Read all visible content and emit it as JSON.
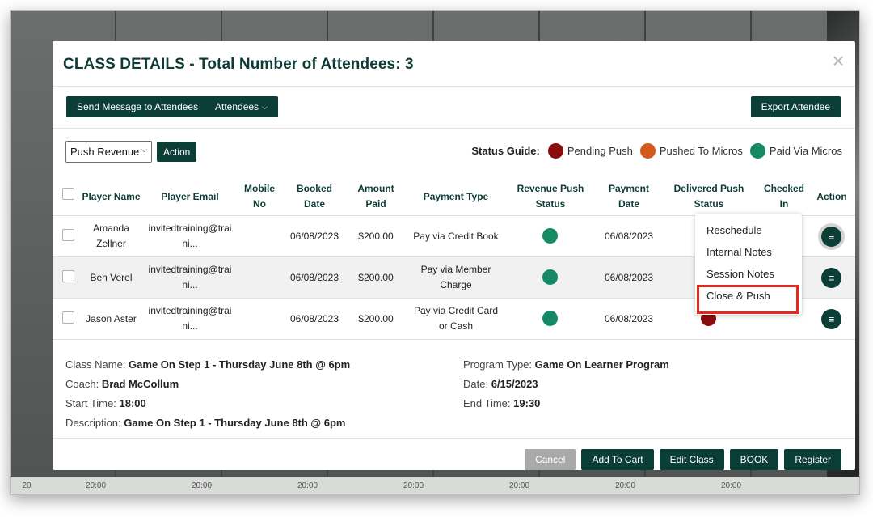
{
  "modal": {
    "title": "CLASS DETAILS - Total Number of Attendees: 3",
    "close_glyph": "×",
    "send_message_label": "Send Message to Attendees",
    "attendees_label": "Attendees",
    "attendees_chevron": "⌵",
    "export_label": "Export Attendee"
  },
  "toolbar": {
    "select_value": "Push Revenue",
    "select_chevron": "⌵",
    "action_label": "Action",
    "status_guide_label": "Status Guide:",
    "statuses": [
      {
        "label": "Pending Push",
        "color": "#8a0d0d"
      },
      {
        "label": "Pushed To Micros",
        "color": "#d45a1c"
      },
      {
        "label": "Paid Via Micros",
        "color": "#158a64"
      }
    ]
  },
  "table": {
    "headers": {
      "player_name": "Player Name",
      "player_email": "Player Email",
      "mobile_1": "Mobile",
      "mobile_2": "No",
      "booked_1": "Booked",
      "booked_2": "Date",
      "amount_1": "Amount",
      "amount_2": "Paid",
      "payment_type": "Payment Type",
      "revenue_1": "Revenue Push",
      "revenue_2": "Status",
      "payment_date_1": "Payment",
      "payment_date_2": "Date",
      "delivered_1": "Delivered Push",
      "delivered_2": "Status",
      "checked_1": "Checked",
      "checked_2": "In",
      "action": "Action"
    },
    "rows": [
      {
        "name_1": "Amanda",
        "name_2": "Zellner",
        "email_1": "invitedtraining@trai",
        "email_2": "ni...",
        "booked": "06/08/2023",
        "amount": "$200.00",
        "payment_type_1": "Pay via Credit Book",
        "payment_type_2": "",
        "payment_date": "06/08/2023"
      },
      {
        "name_1": "Ben Verel",
        "name_2": "",
        "email_1": "invitedtraining@trai",
        "email_2": "ni...",
        "booked": "06/08/2023",
        "amount": "$200.00",
        "payment_type_1": "Pay via Member",
        "payment_type_2": "Charge",
        "payment_date": "06/08/2023"
      },
      {
        "name_1": "Jason Aster",
        "name_2": "",
        "email_1": "invitedtraining@trai",
        "email_2": "ni...",
        "booked": "06/08/2023",
        "amount": "$200.00",
        "payment_type_1": "Pay via Credit Card",
        "payment_type_2": "or Cash",
        "payment_date": "06/08/2023"
      }
    ],
    "menu_icon": "≡"
  },
  "row_menu": {
    "items": [
      "Reschedule",
      "Internal Notes",
      "Session Notes",
      "Close & Push"
    ]
  },
  "details": {
    "class_name_label": "Class Name:",
    "class_name": "Game On Step 1 - Thursday June 8th @ 6pm",
    "coach_label": "Coach:",
    "coach": "Brad McCollum",
    "start_label": "Start Time:",
    "start": "18:00",
    "description_label": "Description:",
    "description": "Game On Step 1 - Thursday June 8th @ 6pm",
    "program_type_label": "Program Type:",
    "program_type": "Game On Learner Program",
    "date_label": "Date:",
    "date": "6/15/2023",
    "end_label": "End Time:",
    "end": "19:30"
  },
  "footer": {
    "cancel": "Cancel",
    "add_to_cart": "Add To Cart",
    "edit_class": "Edit Class",
    "book": "BOOK",
    "register": "Register"
  },
  "background": {
    "times": [
      "20",
      "20:00",
      "20:00",
      "20:00",
      "20:00",
      "20:00",
      "20:00",
      "20:00"
    ]
  }
}
